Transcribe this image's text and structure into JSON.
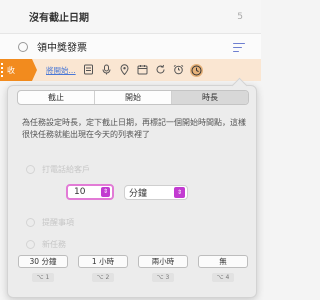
{
  "section": {
    "title": "沒有截止日期",
    "count": "5"
  },
  "task": {
    "title": "領中獎發票"
  },
  "toolbar": {
    "collect_label": "收",
    "link_text": "將開始...",
    "icons": [
      "note-icon",
      "microphone-icon",
      "location-pin-icon",
      "calendar-icon",
      "repeat-icon",
      "alarm-icon",
      "duration-clock-icon"
    ]
  },
  "popover": {
    "tabs": [
      {
        "label": "截止",
        "selected": false
      },
      {
        "label": "開始",
        "selected": false
      },
      {
        "label": "時長",
        "selected": true
      }
    ],
    "description": "為任務設定時長，定下截止日期，再標記一個開始時間點，這樣很快任務就能出現在今天的列表裡了",
    "ghost_items": [
      "打電話給客戶",
      "提醒事項",
      "新任務"
    ],
    "amount": "10",
    "unit": "分鐘",
    "presets": [
      {
        "label": "30 分鐘",
        "shortcut": "⌥ 1"
      },
      {
        "label": "1 小時",
        "shortcut": "⌥ 2"
      },
      {
        "label": "兩小時",
        "shortcut": "⌥ 3"
      },
      {
        "label": "無",
        "shortcut": "⌥ 4"
      }
    ]
  },
  "colors": {
    "accent": "#f28b1e",
    "highlight": "#c23bd1",
    "toolbar_bg": "#fae6d2",
    "link": "#4a78d6"
  }
}
